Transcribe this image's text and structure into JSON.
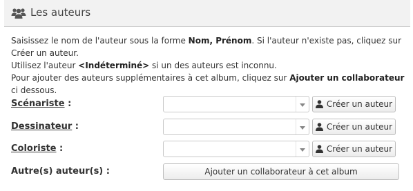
{
  "header": {
    "title": "Les auteurs",
    "icon": "users-icon"
  },
  "intro": {
    "line1_a": "Saisissez le nom de l'auteur sous la forme ",
    "line1_b": "Nom, Prénom",
    "line1_c": ". Si l'auteur n'existe pas, cliquez sur Créer un auteur.",
    "line2_a": "Utilisez l'auteur ",
    "line2_b": "<Indéterminé>",
    "line2_c": " si un des auteurs est inconnu.",
    "line3_a": "Pour ajouter des auteurs supplémentaires à cet album, cliquez sur ",
    "line3_b": "Ajouter un collaborateur",
    "line3_c": " ci dessous."
  },
  "rows": [
    {
      "label": "Scénariste",
      "suffix": " :",
      "select_value": "",
      "button": "Créer un auteur"
    },
    {
      "label": "Dessinateur",
      "suffix": " :",
      "select_value": "",
      "button": "Créer un auteur"
    },
    {
      "label": "Coloriste",
      "suffix": " :",
      "select_value": "",
      "button": "Créer un auteur"
    }
  ],
  "extra": {
    "label": "Autre(s) auteur(s) :",
    "button": "Ajouter un collaborateur à cet album"
  }
}
